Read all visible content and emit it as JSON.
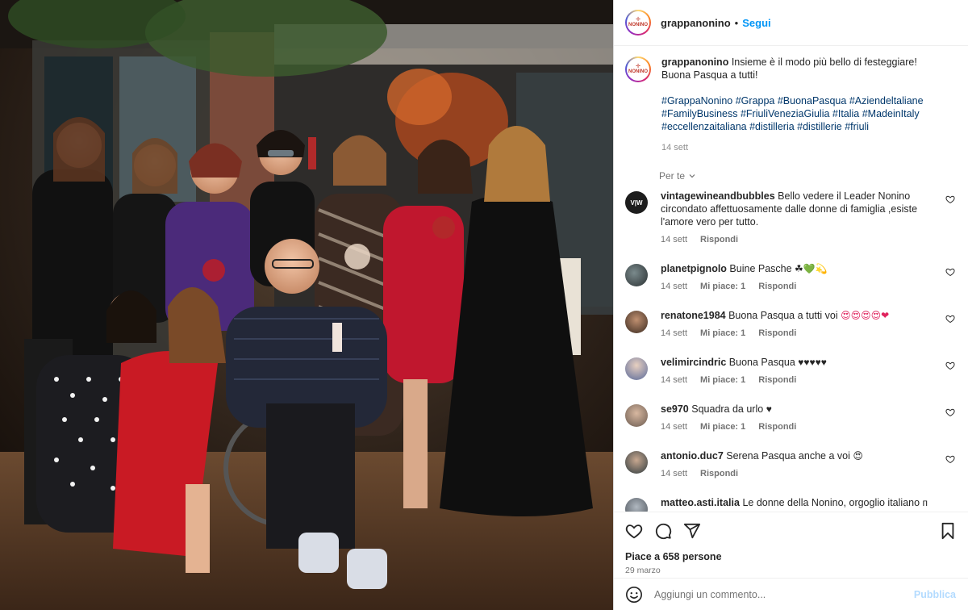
{
  "colors": {
    "accent": "#0095f6",
    "hashtag": "#00376b",
    "muted": "#737373",
    "publish_disabled": "#b3dbff"
  },
  "header": {
    "username": "grappanonino",
    "separator": "•",
    "follow_label": "Segui",
    "avatar_logo_text": "NONINO"
  },
  "caption": {
    "username": "grappanonino",
    "text": "Insieme è il modo più bello di festeggiare! Buona Pasqua a tutti!",
    "line1": "Insieme è il modo più bello di festeggiare!",
    "line2": "Buona Pasqua a tutti!",
    "hashtags_line1": "#GrappaNonino #Grappa #BuonaPasqua #Aziendeltaliane",
    "hashtags_line2": "#FamilyBusiness #FriuliVeneziaGiulia #Italia #MadeinItaly",
    "hashtags_line3": "#eccellenzaitaliana #distilleria #distillerie #friuli",
    "time": "14 sett"
  },
  "translate_label": "Per te",
  "comments": [
    {
      "username": "vintagewineandbubbles",
      "line1": "Bello vedere il Leader Nonino",
      "line2": "circondato affettuosamente dalle donne di famiglia ,esiste",
      "line3": "l'amore vero per tutto.",
      "time": "14 sett",
      "likes": "",
      "reply": "Rispondi",
      "avatar_text": "V|W"
    },
    {
      "username": "planetpignolo",
      "text": "Buine Pasche",
      "emoji": "☘💚💫",
      "time": "14 sett",
      "likes": "Mi piace: 1",
      "reply": "Rispondi"
    },
    {
      "username": "renatone1984",
      "text": "Buona Pasqua a tutti voi",
      "emoji": "😍😍😍😍❤",
      "time": "14 sett",
      "likes": "Mi piace: 1",
      "reply": "Rispondi"
    },
    {
      "username": "velimircindric",
      "text": "Buona Pasqua",
      "emoji": "♥♥♥♥♥",
      "time": "14 sett",
      "likes": "Mi piace: 1",
      "reply": "Rispondi"
    },
    {
      "username": "se970",
      "text": "Squadra da urlo",
      "emoji": "♥",
      "time": "14 sett",
      "likes": "Mi piace: 1",
      "reply": "Rispondi"
    },
    {
      "username": "antonio.duc7",
      "text": "Serena Pasqua anche a voi",
      "emoji": "😍",
      "time": "14 sett",
      "likes": "",
      "reply": "Rispondi"
    },
    {
      "username": "matteo.asti.italia",
      "text": "Le donne della Nonino, orgoglio italiano",
      "emoji": "ᴨ"
    }
  ],
  "actions": {
    "like_icon": "heart-outline-icon",
    "comment_icon": "comment-bubble-icon",
    "share_icon": "paper-plane-icon",
    "save_icon": "bookmark-icon"
  },
  "likes_text": "Piace a 658 persone",
  "post_date": "29 marzo",
  "add_comment": {
    "placeholder": "Aggiungi un commento...",
    "publish_label": "Pubblica"
  }
}
